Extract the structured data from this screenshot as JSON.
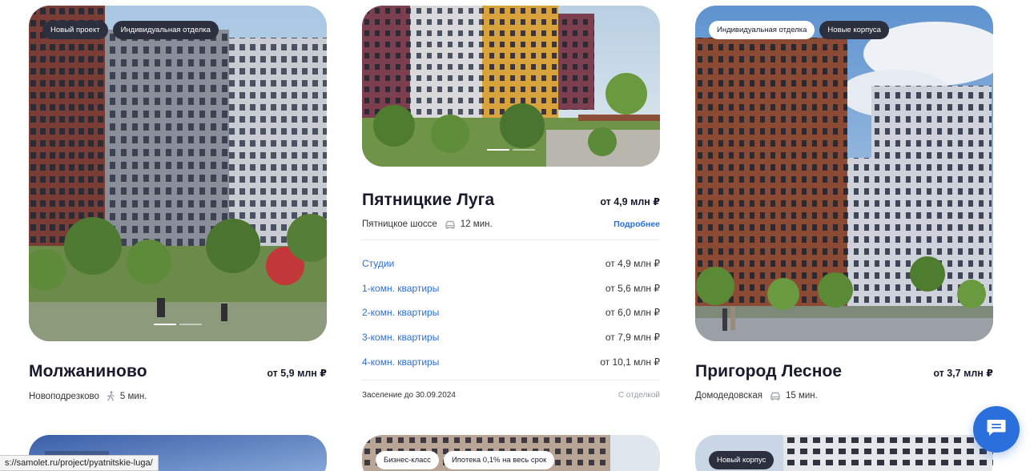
{
  "cards": [
    {
      "title": "Молжаниново",
      "price": "от 5,9 млн ₽",
      "location": "Новоподрезково",
      "transport": "walk-icon",
      "time": "5 мин.",
      "tags": [
        "Новый проект",
        "Индивидуальная отделка"
      ]
    },
    {
      "title": "Пятницкие Луга",
      "price": "от 4,9 млн ₽",
      "location": "Пятницкое шоссе",
      "transport": "car-icon",
      "time": "12 мин.",
      "more": "Подробнее",
      "apartments": [
        {
          "name": "Студии",
          "price": "от 4,9 млн ₽"
        },
        {
          "name": "1-комн. квартиры",
          "price": "от 5,6 млн ₽"
        },
        {
          "name": "2-комн. квартиры",
          "price": "от 6,0 млн ₽"
        },
        {
          "name": "3-комн. квартиры",
          "price": "от 7,9 млн ₽"
        },
        {
          "name": "4-комн. квартиры",
          "price": "от 10,1 млн ₽"
        }
      ],
      "move_in": "Заселение до 30.09.2024",
      "finish": "С отделкой"
    },
    {
      "title": "Пригород Лесное",
      "price": "от 3,7 млн ₽",
      "location": "Домодедовская",
      "transport": "car-icon",
      "time": "15 мин.",
      "tags": [
        "Индивидуальная отделка",
        "Новые корпуса"
      ]
    }
  ],
  "bottom_tags": {
    "middle": [
      "Бизнес-класс",
      "Ипотека 0,1% на весь срок"
    ],
    "right": [
      "Новый корпус"
    ]
  },
  "status_url": "s://samolet.ru/project/pyatnitskie-luga/",
  "colors": {
    "accent": "#2a6fdb",
    "tag_dark": "#2c2f3d",
    "text": "#1a1a2e"
  }
}
